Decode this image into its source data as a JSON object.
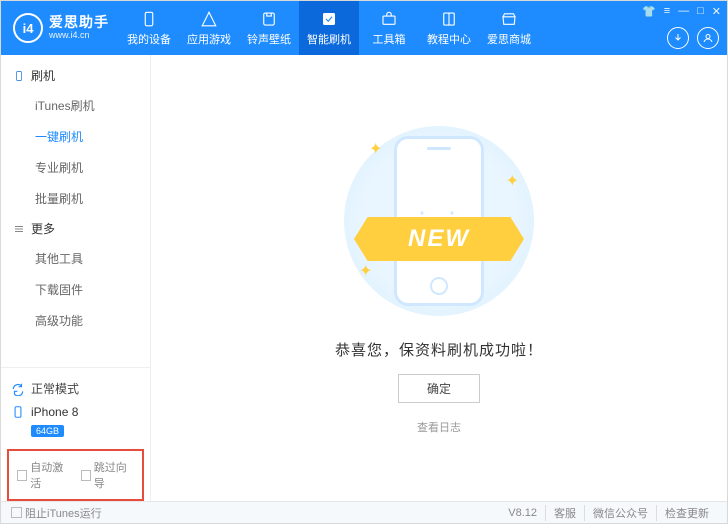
{
  "brand": {
    "cn": "爱思助手",
    "en": "www.i4.cn",
    "mark": "i4"
  },
  "window_controls": [
    "👕",
    "≡",
    "—",
    "□",
    "✕"
  ],
  "header_tabs": [
    {
      "label": "我的设备",
      "icon": "device"
    },
    {
      "label": "应用游戏",
      "icon": "apps"
    },
    {
      "label": "铃声壁纸",
      "icon": "music"
    },
    {
      "label": "智能刷机",
      "icon": "flash",
      "active": true
    },
    {
      "label": "工具箱",
      "icon": "toolbox"
    },
    {
      "label": "教程中心",
      "icon": "book"
    },
    {
      "label": "爱思商城",
      "icon": "shop"
    }
  ],
  "sidebar": {
    "group1": {
      "title": "刷机",
      "items": [
        "iTunes刷机",
        "一键刷机",
        "专业刷机",
        "批量刷机"
      ],
      "active_index": 1
    },
    "group2": {
      "title": "更多",
      "items": [
        "其他工具",
        "下载固件",
        "高级功能"
      ]
    }
  },
  "mode_label": "正常模式",
  "device": {
    "name": "iPhone 8",
    "storage": "64GB"
  },
  "bottom_checks": {
    "a": "自动激活",
    "b": "跳过向导"
  },
  "main": {
    "ribbon": "NEW",
    "message": "恭喜您，保资料刷机成功啦！",
    "ok": "确定",
    "view_log": "查看日志"
  },
  "footer": {
    "block_itunes": "阻止iTunes运行",
    "version": "V8.12",
    "links": [
      "客服",
      "微信公众号",
      "检查更新"
    ]
  }
}
